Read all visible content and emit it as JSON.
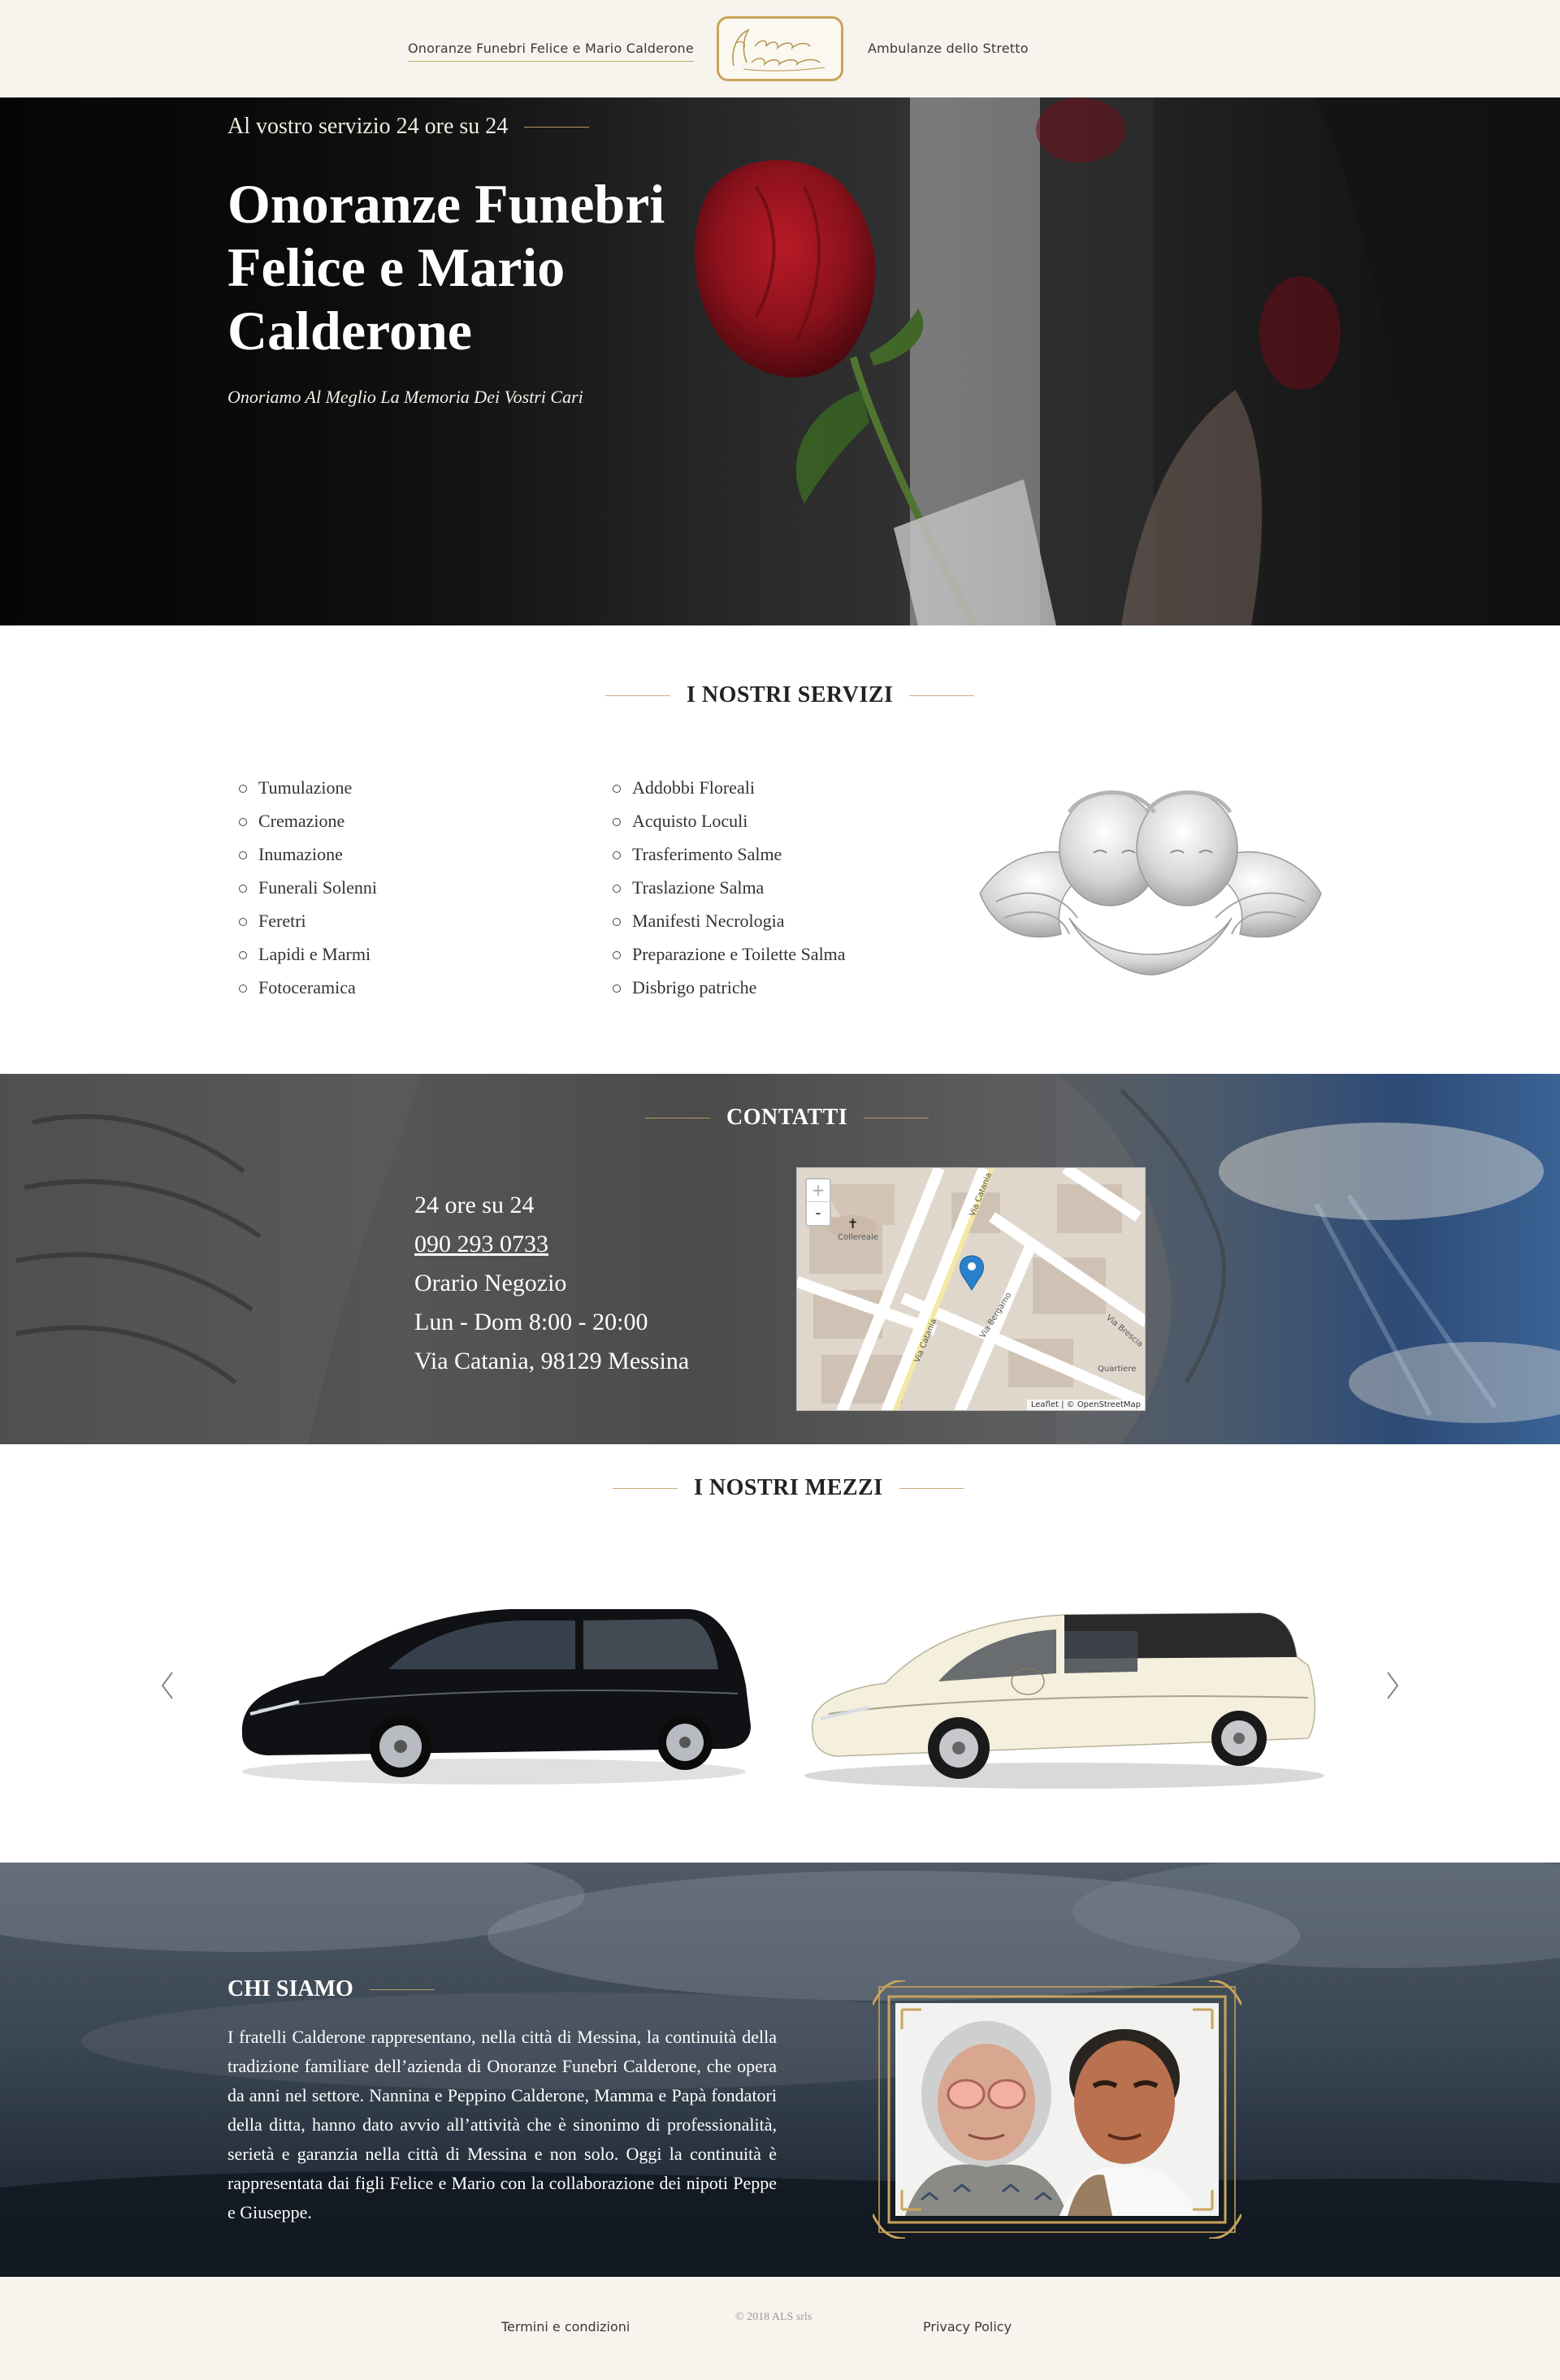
{
  "nav": {
    "left_link": "Onoranze Funebri Felice e Mario Calderone",
    "right_link": "Ambulanze dello Stretto",
    "logo_text": "Fratelli Calderone"
  },
  "hero": {
    "kicker": "Al vostro servizio 24 ore su 24",
    "title": "Onoranze Funebri Felice e Mario Calderone",
    "subtitle": "Onoriamo Al Meglio La Memoria Dei Vostri Cari"
  },
  "services": {
    "heading": "I NOSTRI SERVIZI",
    "col1": [
      "Tumulazione",
      "Cremazione",
      "Inumazione",
      "Funerali Solenni",
      "Feretri",
      "Lapidi e Marmi",
      "Fotoceramica"
    ],
    "col2": [
      "Addobbi Floreali",
      "Acquisto Loculi",
      "Trasferimento Salme",
      "Traslazione Salma",
      "Manifesti Necrologia",
      "Preparazione e Toilette Salma",
      "Disbrigo patriche"
    ]
  },
  "contacts": {
    "heading": "CONTATTI",
    "hours_24": "24 ore su 24",
    "phone": "090 293 0733",
    "shop_hours_label": "Orario Negozio",
    "shop_hours": "Lun - Dom 8:00 - 20:00",
    "address": "Via Catania, 98129 Messina",
    "map": {
      "zoom_in": "+",
      "zoom_out": "-",
      "attribution": "Leaflet | © OpenStreetMap",
      "labels": {
        "church": "Collereale",
        "street1": "Via Catania",
        "street2": "Via Catania",
        "street3": "Via Bergamo",
        "street4": "Via Brescia",
        "district": "Quartiere"
      }
    }
  },
  "vehicles": {
    "heading": "I NOSTRI MEZZI"
  },
  "about": {
    "heading": "CHI SIAMO",
    "text": "I fratelli Calderone rappresentano, nella città di Messina, la continuità della tradizione familiare dell’azienda di Onoranze Funebri Calderone, che opera da anni nel settore. Nannina e Peppino Calderone, Mamma e Papà fondatori della ditta, hanno dato avvio all’attività che è sinonimo di professionalità, serietà e garanzia nella città di Messina e non solo. Oggi la continuità è rappresentata dai figli Felice e Mario con la collaborazione dei nipoti Peppe e Giuseppe."
  },
  "footer": {
    "terms": "Termini e condizioni",
    "copyright": "© 2018 ALS srls",
    "privacy": "Privacy Policy"
  },
  "colors": {
    "cream": "#f7f4ee",
    "gold": "#c9a45a",
    "rule": "#d4a97a"
  }
}
